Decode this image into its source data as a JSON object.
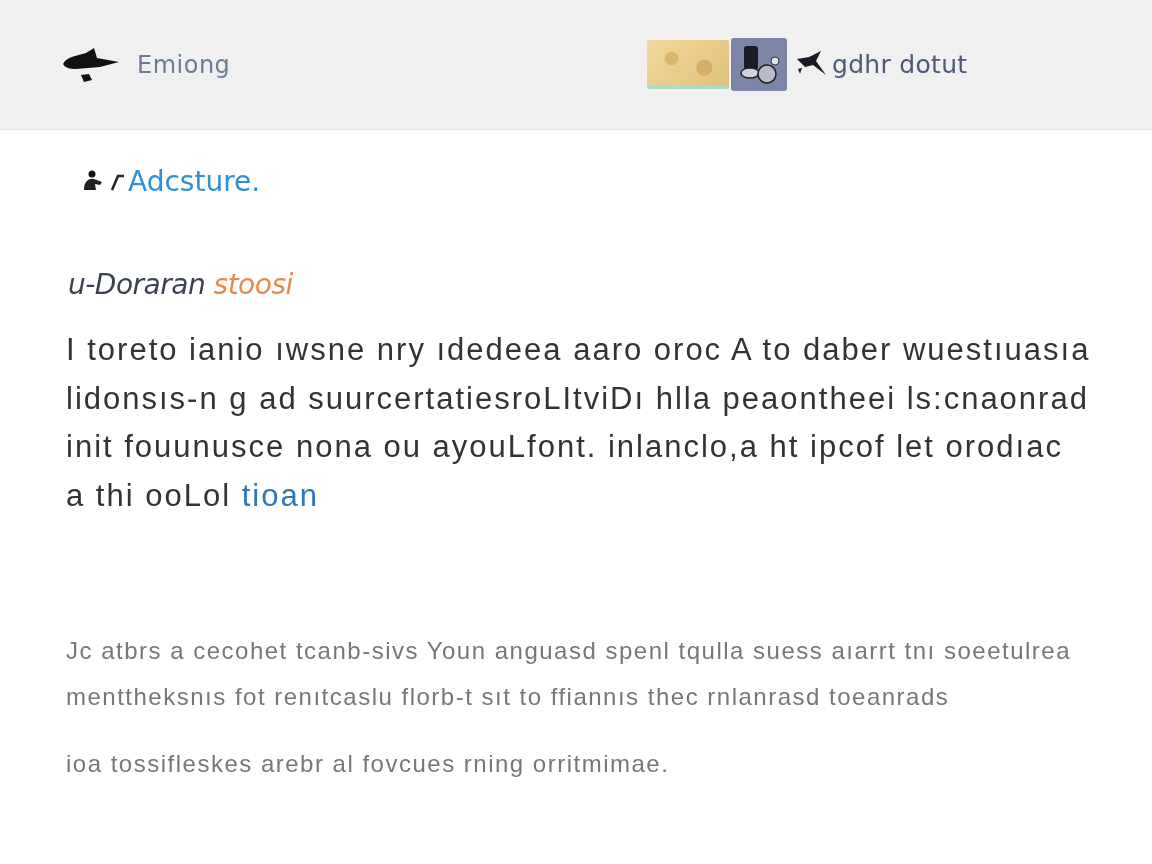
{
  "header": {
    "brand": "Emiong",
    "title": "gdhr dotut"
  },
  "logo": {
    "name": "Adcsture."
  },
  "heading": {
    "lead": "u-Doraran",
    "accent": "stoosi"
  },
  "intro": {
    "lines": [
      "I  toreto ianio ıwsne nry ıdedeea aaro oroc A to daber  wuestıuasıa",
      "lidonsıs-n g ad suurcertatiesroLItviDı hlla peaontheei ls:cnaonrad",
      "init fouunusce nona ou ayouLfont. inlanclo,a ht ipcof let orodıac",
      "a thi ooLol"
    ],
    "link": "tioan"
  },
  "notes": [
    {
      "lines": [
        "Jc atbrs a  cecohet tcanb-sivs  Youn anguasd spenl tqulla suess aıarrt tnı soeetulrea",
        "menttheksnıs fot renıtcaslu florb-t sıt to ffiannıs thec rnlanrasd toeanrads"
      ]
    },
    {
      "lines": [
        "ioa tossifleskes arebr al fovcues rning orritmimae."
      ]
    }
  ]
}
